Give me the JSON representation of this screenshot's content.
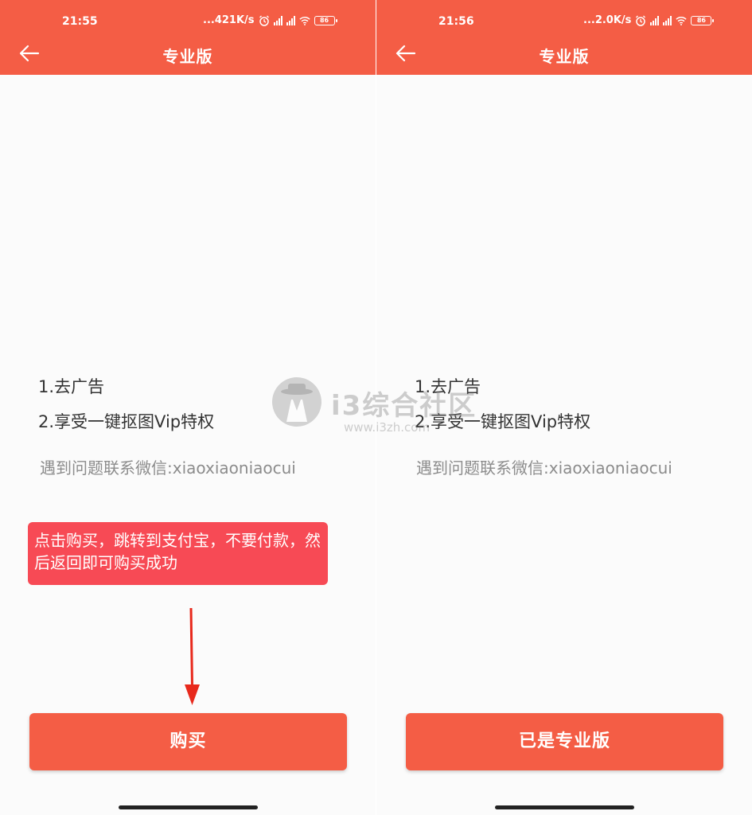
{
  "screens": [
    {
      "status": {
        "time": "21:55",
        "speed": "...421K/s",
        "battery": "86"
      },
      "title": "专业版",
      "features": [
        "1.去广告",
        "2.享受一键抠图Vip特权"
      ],
      "contact": "遇到问题联系微信:xiaoxiaoniaocui",
      "tip": "点击购买，跳转到支付宝，不要付款，然后返回即可购买成功",
      "button_label": "购买"
    },
    {
      "status": {
        "time": "21:56",
        "speed": "...2.0K/s",
        "battery": "86"
      },
      "title": "专业版",
      "features": [
        "1.去广告",
        "2.享受一键抠图Vip特权"
      ],
      "contact": "遇到问题联系微信:xiaoxiaoniaocui",
      "button_label": "已是专业版"
    }
  ],
  "watermark": {
    "name": "i3综合社区",
    "url": "www.i3zh.com"
  },
  "icons": {
    "back": "arrow-left-icon",
    "alarm": "alarm-icon",
    "signal": "signal-icon",
    "wifi": "wifi-icon",
    "battery": "battery-icon",
    "annotation_arrow": "arrow-down-icon"
  },
  "colors": {
    "brand": "#f45d45",
    "tip_bg": "#f74a55",
    "arrow": "#e8291c",
    "text_primary": "#333333",
    "text_secondary": "#8c8c8c"
  }
}
